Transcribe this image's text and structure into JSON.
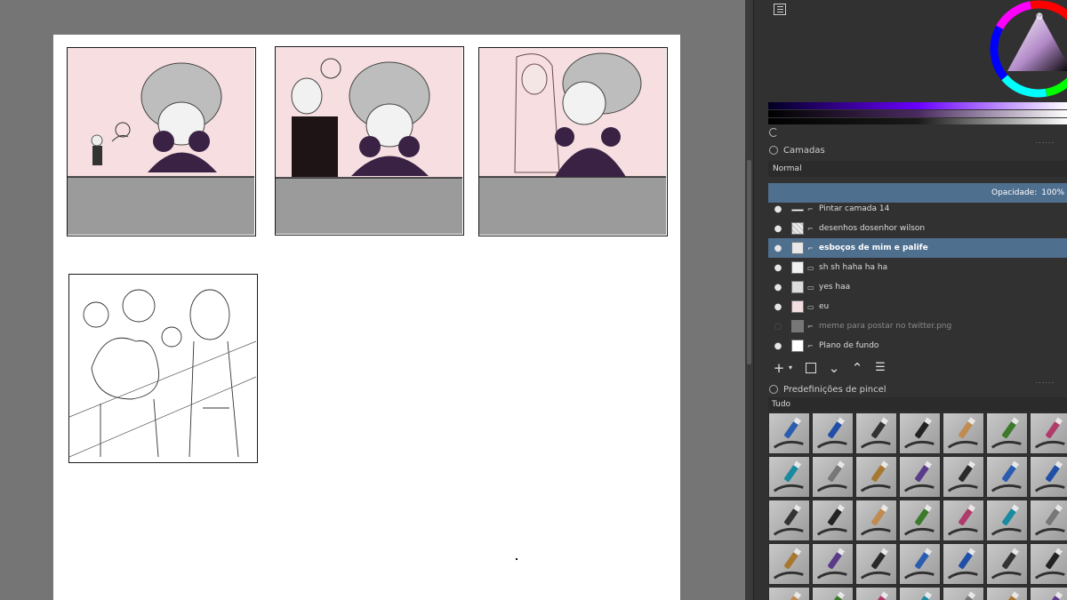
{
  "layers_docker": {
    "title": "Camadas",
    "blend_mode": "Normal",
    "opacity_label": "Opacidade:",
    "opacity_value": "100%",
    "layers": [
      {
        "name": "Pintar camada 14",
        "visible": true,
        "selected": false
      },
      {
        "name": "desenhos dosenhor wilson",
        "visible": true,
        "selected": false
      },
      {
        "name": "esboços de mim e palife",
        "visible": true,
        "selected": true
      },
      {
        "name": "sh sh haha ha ha",
        "visible": true,
        "selected": false
      },
      {
        "name": "yes haa",
        "visible": true,
        "selected": false
      },
      {
        "name": "eu",
        "visible": true,
        "selected": false
      },
      {
        "name": "meme para postar no twitter.png",
        "visible": false,
        "selected": false
      },
      {
        "name": "Plano de fundo",
        "visible": true,
        "selected": false
      }
    ]
  },
  "brush_docker": {
    "title": "Predefinições de pincel",
    "tag_filter": "Tudo"
  },
  "icons": {
    "eye": "eye-icon",
    "lock": "lock-icon",
    "add": "plus-icon",
    "duplicate": "duplicate-icon",
    "move_down": "chevron-down-icon",
    "move_up": "chevron-up-icon",
    "properties": "sliders-icon",
    "refresh": "refresh-icon",
    "docker_menu": "list-icon"
  },
  "colors": {
    "selected_layer": "#4f6f8f",
    "docker_bg": "#313131",
    "canvas_bg": "#757575"
  }
}
